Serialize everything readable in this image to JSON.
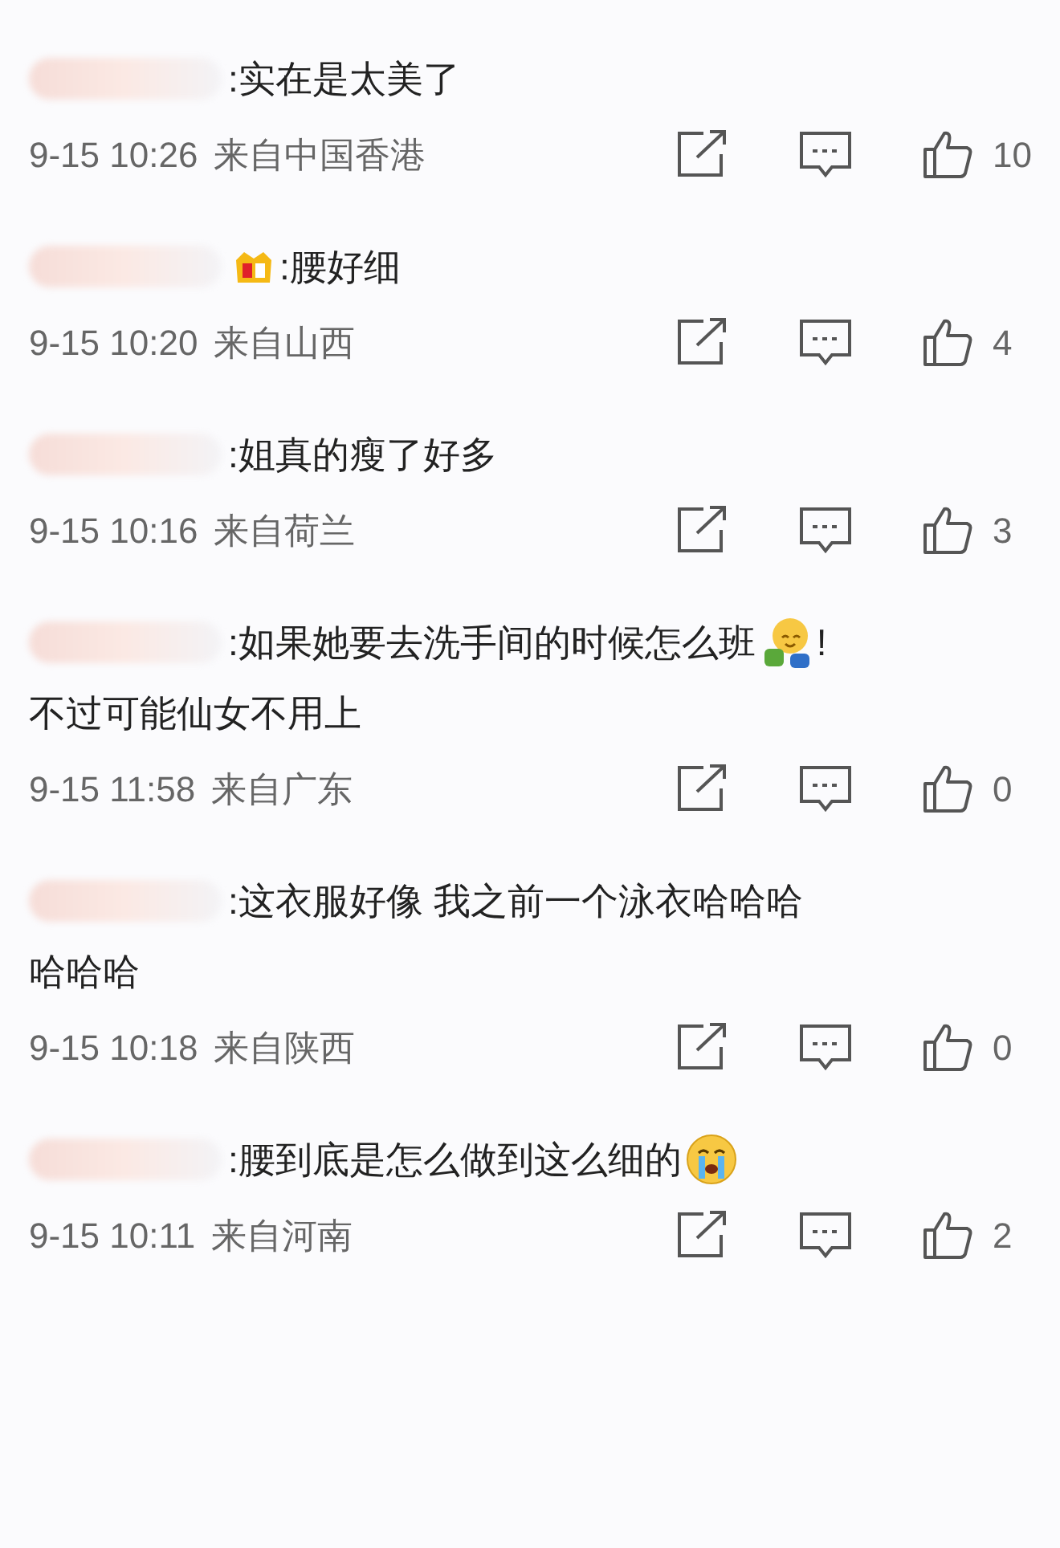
{
  "comments": [
    {
      "lines": [
        [
          {
            "kind": "blur"
          },
          {
            "kind": "text",
            "text": ":实在是太美了"
          }
        ]
      ],
      "time": "9-15 10:26",
      "location": "来自中国香港",
      "likes": "10"
    },
    {
      "lines": [
        [
          {
            "kind": "blur"
          },
          {
            "kind": "crown"
          },
          {
            "kind": "text",
            "text": ":腰好细"
          }
        ]
      ],
      "time": "9-15 10:20",
      "location": "来自山西",
      "likes": "4"
    },
    {
      "lines": [
        [
          {
            "kind": "blur"
          },
          {
            "kind": "text",
            "text": ":姐真的瘦了好多"
          }
        ]
      ],
      "time": "9-15 10:16",
      "location": "来自荷兰",
      "likes": "3"
    },
    {
      "lines": [
        [
          {
            "kind": "blur"
          },
          {
            "kind": "text",
            "text": ":如果她要去洗手间的时候怎么班"
          },
          {
            "kind": "hug"
          },
          {
            "kind": "text",
            "text": "!"
          }
        ],
        [
          {
            "kind": "text",
            "text": "不过可能仙女不用上"
          }
        ]
      ],
      "time": "9-15 11:58",
      "location": "来自广东",
      "likes": "0"
    },
    {
      "lines": [
        [
          {
            "kind": "blur"
          },
          {
            "kind": "text",
            "text": ":这衣服好像 我之前一个泳衣哈哈哈"
          }
        ],
        [
          {
            "kind": "text",
            "text": "哈哈哈"
          }
        ]
      ],
      "time": "9-15 10:18",
      "location": "来自陕西",
      "likes": "0"
    },
    {
      "lines": [
        [
          {
            "kind": "blur"
          },
          {
            "kind": "text",
            "text": ":腰到底是怎么做到这么细的"
          },
          {
            "kind": "cry"
          }
        ]
      ],
      "time": "9-15 10:11",
      "location": "来自河南",
      "likes": "2"
    }
  ]
}
